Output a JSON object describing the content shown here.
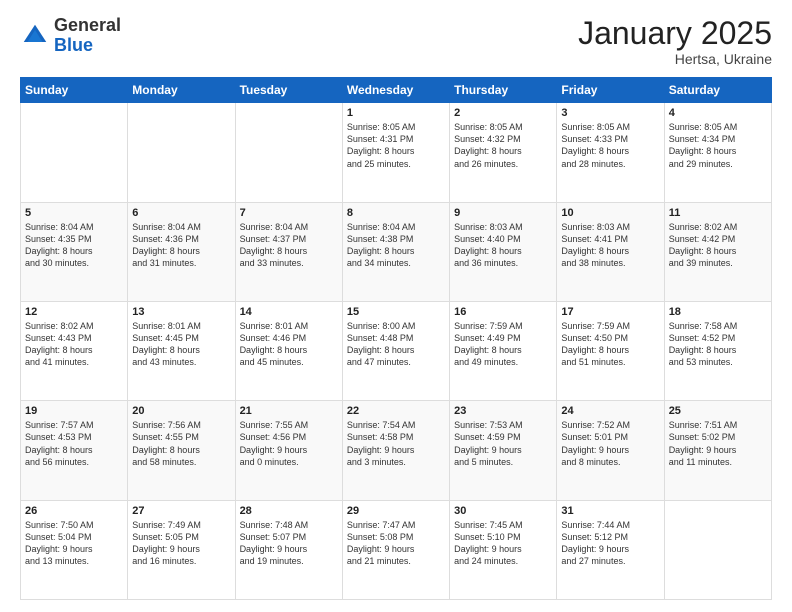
{
  "logo": {
    "general": "General",
    "blue": "Blue"
  },
  "header": {
    "month": "January 2025",
    "location": "Hertsa, Ukraine"
  },
  "weekdays": [
    "Sunday",
    "Monday",
    "Tuesday",
    "Wednesday",
    "Thursday",
    "Friday",
    "Saturday"
  ],
  "weeks": [
    [
      {
        "day": "",
        "info": ""
      },
      {
        "day": "",
        "info": ""
      },
      {
        "day": "",
        "info": ""
      },
      {
        "day": "1",
        "info": "Sunrise: 8:05 AM\nSunset: 4:31 PM\nDaylight: 8 hours\nand 25 minutes."
      },
      {
        "day": "2",
        "info": "Sunrise: 8:05 AM\nSunset: 4:32 PM\nDaylight: 8 hours\nand 26 minutes."
      },
      {
        "day": "3",
        "info": "Sunrise: 8:05 AM\nSunset: 4:33 PM\nDaylight: 8 hours\nand 28 minutes."
      },
      {
        "day": "4",
        "info": "Sunrise: 8:05 AM\nSunset: 4:34 PM\nDaylight: 8 hours\nand 29 minutes."
      }
    ],
    [
      {
        "day": "5",
        "info": "Sunrise: 8:04 AM\nSunset: 4:35 PM\nDaylight: 8 hours\nand 30 minutes."
      },
      {
        "day": "6",
        "info": "Sunrise: 8:04 AM\nSunset: 4:36 PM\nDaylight: 8 hours\nand 31 minutes."
      },
      {
        "day": "7",
        "info": "Sunrise: 8:04 AM\nSunset: 4:37 PM\nDaylight: 8 hours\nand 33 minutes."
      },
      {
        "day": "8",
        "info": "Sunrise: 8:04 AM\nSunset: 4:38 PM\nDaylight: 8 hours\nand 34 minutes."
      },
      {
        "day": "9",
        "info": "Sunrise: 8:03 AM\nSunset: 4:40 PM\nDaylight: 8 hours\nand 36 minutes."
      },
      {
        "day": "10",
        "info": "Sunrise: 8:03 AM\nSunset: 4:41 PM\nDaylight: 8 hours\nand 38 minutes."
      },
      {
        "day": "11",
        "info": "Sunrise: 8:02 AM\nSunset: 4:42 PM\nDaylight: 8 hours\nand 39 minutes."
      }
    ],
    [
      {
        "day": "12",
        "info": "Sunrise: 8:02 AM\nSunset: 4:43 PM\nDaylight: 8 hours\nand 41 minutes."
      },
      {
        "day": "13",
        "info": "Sunrise: 8:01 AM\nSunset: 4:45 PM\nDaylight: 8 hours\nand 43 minutes."
      },
      {
        "day": "14",
        "info": "Sunrise: 8:01 AM\nSunset: 4:46 PM\nDaylight: 8 hours\nand 45 minutes."
      },
      {
        "day": "15",
        "info": "Sunrise: 8:00 AM\nSunset: 4:48 PM\nDaylight: 8 hours\nand 47 minutes."
      },
      {
        "day": "16",
        "info": "Sunrise: 7:59 AM\nSunset: 4:49 PM\nDaylight: 8 hours\nand 49 minutes."
      },
      {
        "day": "17",
        "info": "Sunrise: 7:59 AM\nSunset: 4:50 PM\nDaylight: 8 hours\nand 51 minutes."
      },
      {
        "day": "18",
        "info": "Sunrise: 7:58 AM\nSunset: 4:52 PM\nDaylight: 8 hours\nand 53 minutes."
      }
    ],
    [
      {
        "day": "19",
        "info": "Sunrise: 7:57 AM\nSunset: 4:53 PM\nDaylight: 8 hours\nand 56 minutes."
      },
      {
        "day": "20",
        "info": "Sunrise: 7:56 AM\nSunset: 4:55 PM\nDaylight: 8 hours\nand 58 minutes."
      },
      {
        "day": "21",
        "info": "Sunrise: 7:55 AM\nSunset: 4:56 PM\nDaylight: 9 hours\nand 0 minutes."
      },
      {
        "day": "22",
        "info": "Sunrise: 7:54 AM\nSunset: 4:58 PM\nDaylight: 9 hours\nand 3 minutes."
      },
      {
        "day": "23",
        "info": "Sunrise: 7:53 AM\nSunset: 4:59 PM\nDaylight: 9 hours\nand 5 minutes."
      },
      {
        "day": "24",
        "info": "Sunrise: 7:52 AM\nSunset: 5:01 PM\nDaylight: 9 hours\nand 8 minutes."
      },
      {
        "day": "25",
        "info": "Sunrise: 7:51 AM\nSunset: 5:02 PM\nDaylight: 9 hours\nand 11 minutes."
      }
    ],
    [
      {
        "day": "26",
        "info": "Sunrise: 7:50 AM\nSunset: 5:04 PM\nDaylight: 9 hours\nand 13 minutes."
      },
      {
        "day": "27",
        "info": "Sunrise: 7:49 AM\nSunset: 5:05 PM\nDaylight: 9 hours\nand 16 minutes."
      },
      {
        "day": "28",
        "info": "Sunrise: 7:48 AM\nSunset: 5:07 PM\nDaylight: 9 hours\nand 19 minutes."
      },
      {
        "day": "29",
        "info": "Sunrise: 7:47 AM\nSunset: 5:08 PM\nDaylight: 9 hours\nand 21 minutes."
      },
      {
        "day": "30",
        "info": "Sunrise: 7:45 AM\nSunset: 5:10 PM\nDaylight: 9 hours\nand 24 minutes."
      },
      {
        "day": "31",
        "info": "Sunrise: 7:44 AM\nSunset: 5:12 PM\nDaylight: 9 hours\nand 27 minutes."
      },
      {
        "day": "",
        "info": ""
      }
    ]
  ]
}
